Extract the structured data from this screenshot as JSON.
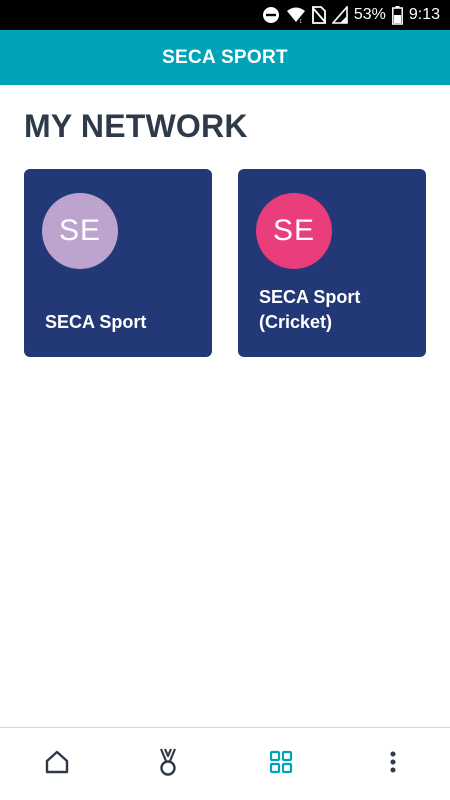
{
  "status_bar": {
    "battery_percent": "53%",
    "time": "9:13",
    "icons": [
      "do-not-disturb-icon",
      "wifi-icon",
      "no-sim-icon",
      "signal-icon",
      "battery-icon"
    ]
  },
  "app_bar": {
    "title": "SECA SPORT"
  },
  "section": {
    "title": "MY NETWORK"
  },
  "network_cards": [
    {
      "initials": "SE",
      "name": "SECA Sport",
      "avatar_color": "#bca4cf"
    },
    {
      "initials": "SE",
      "name": "SECA Sport\n(Cricket)",
      "avatar_color": "#ea3d7c"
    }
  ],
  "bottom_nav": {
    "items": [
      {
        "icon": "home-icon",
        "active": false
      },
      {
        "icon": "medal-icon",
        "active": false
      },
      {
        "icon": "grid-icon",
        "active": true
      },
      {
        "icon": "more-vertical-icon",
        "active": false
      }
    ],
    "active_color": "#00a3b8",
    "inactive_color": "#2e3a4a"
  },
  "colors": {
    "accent": "#00a3b8",
    "card_background": "#233876",
    "heading": "#2e3a4a"
  }
}
